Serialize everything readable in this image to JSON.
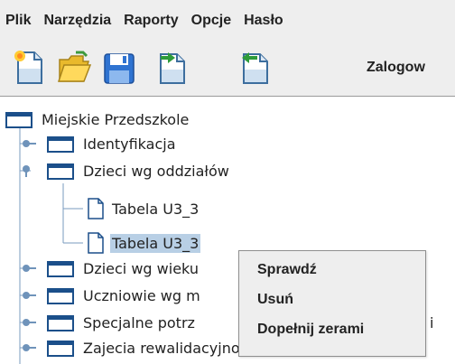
{
  "menubar": {
    "items": [
      "Plik",
      "Narzędzia",
      "Raporty",
      "Opcje",
      "Hasło"
    ]
  },
  "toolbar": {
    "buttons": [
      {
        "icon": "new-document-icon"
      },
      {
        "icon": "open-folder-icon"
      },
      {
        "icon": "save-disk-icon"
      },
      {
        "icon": "export-document-icon"
      },
      {
        "icon": "import-document-icon"
      }
    ],
    "logged_label": "Zalogow"
  },
  "tree": {
    "root": "Miejskie Przedszkole",
    "nodes": [
      {
        "label": "Identyfikacja",
        "expanded": false
      },
      {
        "label": "Dzieci wg oddziałów",
        "expanded": true,
        "children": [
          {
            "label": "Tabela U3_3",
            "selected": false
          },
          {
            "label": "Tabela U3_3",
            "selected": true
          }
        ]
      },
      {
        "label": "Dzieci wg wieku",
        "expanded": false
      },
      {
        "label": "Uczniowie wg m",
        "expanded": false
      },
      {
        "label": "Specjalne potrz",
        "suffix": "i",
        "expanded": false
      },
      {
        "label": "Zajecia rewalidacyjno wychowawcze",
        "expanded": false
      }
    ]
  },
  "context_menu": {
    "items": [
      "Sprawdź",
      "Usuń",
      "Dopełnij zerami"
    ]
  },
  "colors": {
    "selection": "#b8cfe5",
    "folder": "#1b4f8a",
    "tree_line": "#7a9bbf",
    "background": "#eeeeee"
  }
}
